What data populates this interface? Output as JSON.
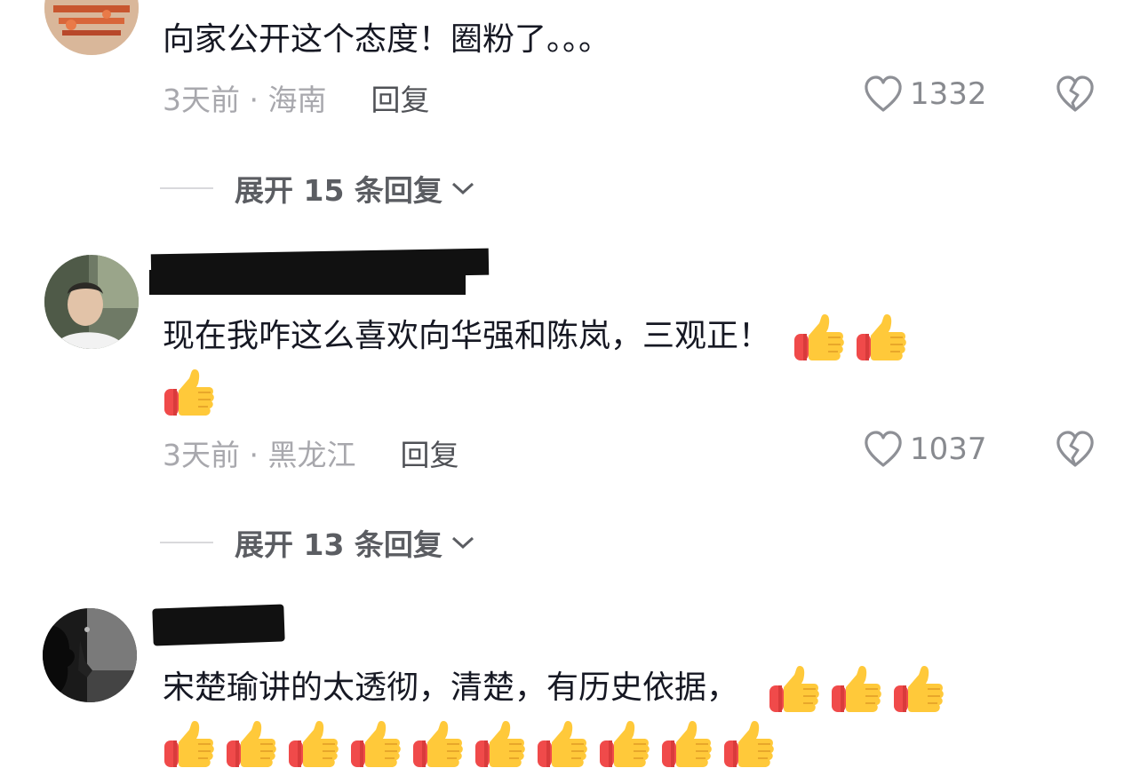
{
  "comments": [
    {
      "text": "向家公开这个态度！圈粉了。。。",
      "time_location": "3天前 · 海南",
      "reply_label": "回复",
      "likes": "1332",
      "expand_label": "展开 15 条回复",
      "thumbs": 0
    },
    {
      "text": "现在我咋这么喜欢向华强和陈岚，三观正！",
      "time_location": "3天前 · 黑龙江",
      "reply_label": "回复",
      "likes": "1037",
      "expand_label": "展开 13 条回复",
      "thumbs": 3
    },
    {
      "text": "宋楚瑜讲的太透彻，清楚，有历史依据，",
      "thumbs": 13
    }
  ],
  "icons": {
    "like": "heart-outline-icon",
    "dislike": "broken-heart-icon",
    "expand": "chevron-down-icon",
    "emoji": "thumbs-up-emoji"
  },
  "colors": {
    "text": "#161823",
    "meta": "#a8a8ad",
    "expand": "#5b5d62",
    "thumb_fill": "#ffc93a",
    "thumb_cuff": "#f04a4a"
  }
}
